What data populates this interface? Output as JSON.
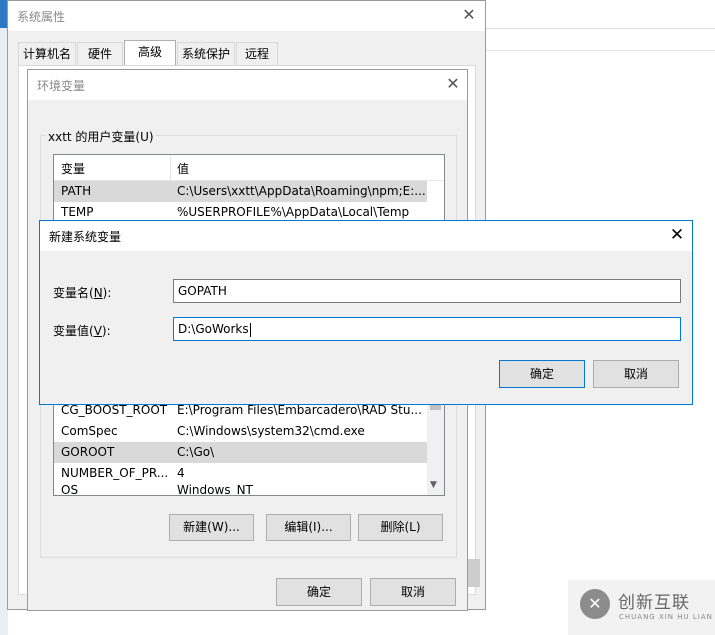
{
  "system_properties": {
    "title": "系统属性",
    "tabs": [
      "计算机名",
      "硬件",
      "高级",
      "系统保护",
      "远程"
    ],
    "active_tab": "高级",
    "ok": "确定",
    "cancel": "取消"
  },
  "env_vars": {
    "title": "环境变量",
    "user_group_label": "xxtt 的用户变量(U)",
    "columns": [
      "变量",
      "值"
    ],
    "user_vars": [
      {
        "name": "PATH",
        "value": "C:\\Users\\xxtt\\AppData\\Roaming\\npm;E:..."
      },
      {
        "name": "TEMP",
        "value": "%USERPROFILE%\\AppData\\Local\\Temp"
      }
    ],
    "system_vars": [
      {
        "name": "CG_BOOST_ROOT",
        "value": "E:\\Program Files\\Embarcadero\\RAD Stu..."
      },
      {
        "name": "ComSpec",
        "value": "C:\\Windows\\system32\\cmd.exe"
      },
      {
        "name": "GOROOT",
        "value": "C:\\Go\\"
      },
      {
        "name": "NUMBER_OF_PR...",
        "value": "4"
      },
      {
        "name": "OS",
        "value": "Windows_NT"
      }
    ],
    "new_button": "新建(W)...",
    "edit_button": "编辑(I)...",
    "delete_button": "删除(L)",
    "ok": "确定",
    "cancel": "取消"
  },
  "new_var_dialog": {
    "title": "新建系统变量",
    "name_label_pre": "变量名(",
    "name_label_key": "N",
    "name_label_post": "):",
    "value_label_pre": "变量值(",
    "value_label_key": "V",
    "value_label_post": "):",
    "name_value": "GOPATH",
    "value_value": "D:\\GoWorks",
    "ok": "确定",
    "cancel": "取消"
  },
  "watermark": {
    "brand_cn": "创新互联",
    "brand_en": "CHUANG XIN HU LIAN"
  },
  "icons": [
    "close-icon",
    "scroll-up-icon",
    "scroll-down-icon",
    "brand-logo-icon"
  ]
}
